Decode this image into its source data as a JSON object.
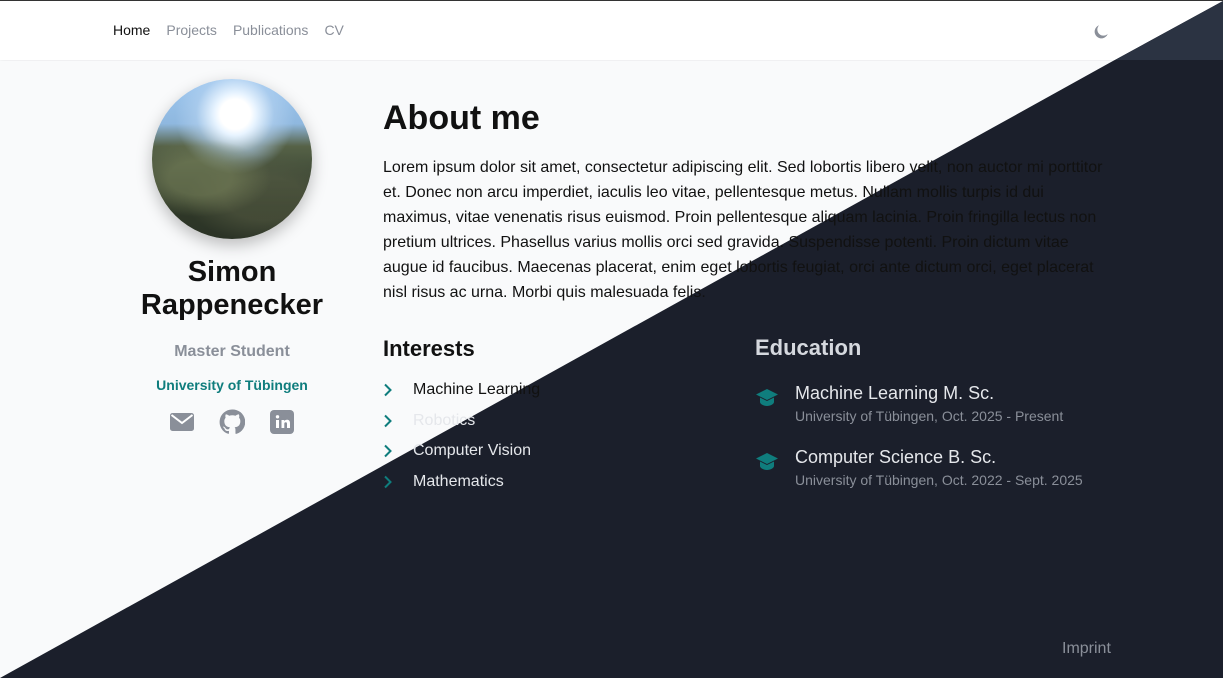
{
  "nav": {
    "items": [
      {
        "label": "Home",
        "active": true
      },
      {
        "label": "Projects",
        "active": false
      },
      {
        "label": "Publications",
        "active": false
      },
      {
        "label": "CV",
        "active": false
      }
    ],
    "theme_toggle_icon": "moon-icon"
  },
  "profile": {
    "name": "Simon Rappenecker",
    "role": "Master Student",
    "university": "University of Tübingen",
    "socials": [
      "mail-icon",
      "github-icon",
      "linkedin-icon"
    ]
  },
  "about": {
    "title": "About me",
    "text": "Lorem ipsum dolor sit amet, consectetur adipiscing elit. Sed lobortis libero velit, non auctor mi porttitor et. Donec non arcu imperdiet, iaculis leo vitae, pellentesque metus. Nullam mollis turpis id dui maximus, vitae venenatis risus euismod. Proin pellentesque aliquam lacinia. Proin fringilla lectus non pretium ultrices. Phasellus varius mollis orci sed gravida. Suspendisse potenti. Proin dictum vitae augue id faucibus. Maecenas placerat, enim eget lobortis feugiat, orci ante dictum orci, eget placerat nisl risus ac urna. Morbi quis malesuada felis."
  },
  "interests": {
    "title": "Interests",
    "items": [
      "Machine Learning",
      "Robotics",
      "Computer Vision",
      "Mathematics"
    ]
  },
  "education": {
    "title": "Education",
    "items": [
      {
        "degree": "Machine Learning M. Sc.",
        "detail": "University of Tübingen, Oct. 2025 - Present"
      },
      {
        "degree": "Computer Science B. Sc.",
        "detail": "University of Tübingen, Oct. 2022 - Sept. 2025"
      }
    ]
  },
  "footer": {
    "imprint": "Imprint"
  },
  "colors": {
    "accent": "#0f7d7d",
    "dark_bg": "#1b1f2b",
    "light_bg": "#f9fafb",
    "muted": "#8a8f99"
  }
}
